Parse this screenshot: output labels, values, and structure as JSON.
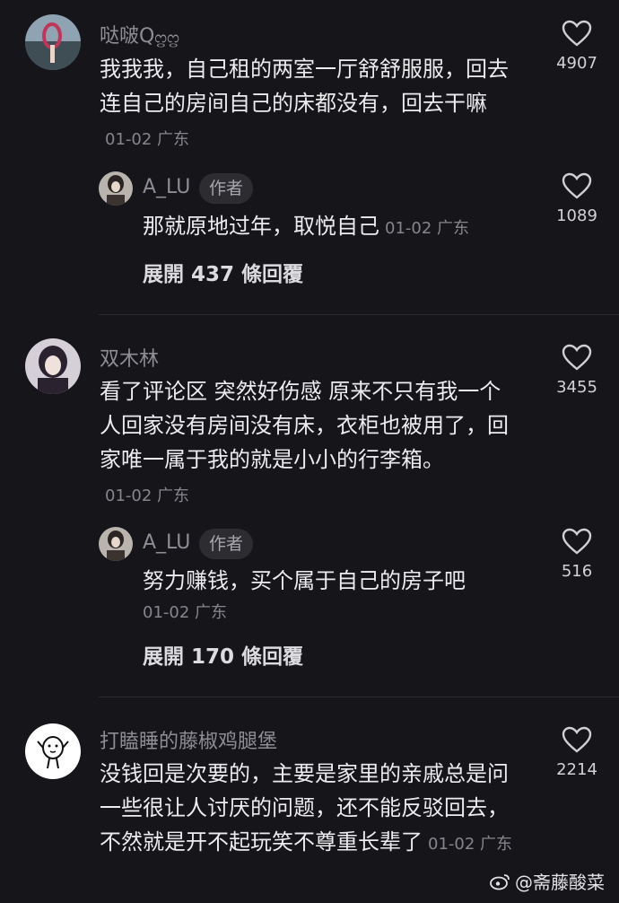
{
  "comments": [
    {
      "username": "哒啵Q",
      "username_suffix": "ᦦᦦ",
      "text": "我我我，自己租的两室一厅舒舒服服，回去连自己的房间自己的床都没有，回去干嘛",
      "date": "01-02",
      "location": "广东",
      "likes": "4907",
      "reply": {
        "username": "A_LU",
        "badge": "作者",
        "text": "那就原地过年，取悦自己",
        "date": "01-02",
        "location": "广东",
        "likes": "1089"
      },
      "expand": "展開 437 條回覆"
    },
    {
      "username": "双木林",
      "text": "看了评论区 突然好伤感 原来不只有我一个人回家没有房间没有床，衣柜也被用了，回家唯一属于我的就是小小的行李箱。",
      "date": "01-02",
      "location": "广东",
      "likes": "3455",
      "reply": {
        "username": "A_LU",
        "badge": "作者",
        "text": "努力赚钱，买个属于自己的房子吧",
        "date": "01-02",
        "location": "广东",
        "likes": "516"
      },
      "expand": "展開 170 條回覆"
    },
    {
      "username": "打瞌睡的藤椒鸡腿堡",
      "text": "没钱回是次要的，主要是家里的亲戚总是问一些很让人讨厌的问题，还不能反驳回去，不然就是开不起玩笑不尊重长辈了",
      "date": "01-02",
      "location": "广东",
      "likes": "2214"
    }
  ],
  "watermark": "@斋藤酸菜",
  "icons": {
    "like": "heart-outline-icon",
    "watermark": "weibo-logo-icon"
  }
}
